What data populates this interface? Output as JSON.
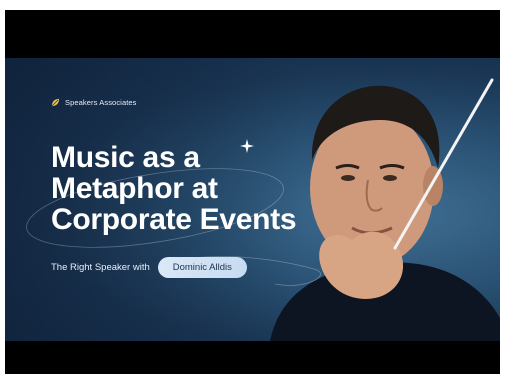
{
  "brand": {
    "name": "Speakers Associates",
    "logo_icon": "leaf-logo-icon"
  },
  "headline": {
    "line1": "Music as a",
    "line2": "Metaphor at",
    "line3": "Corporate Events"
  },
  "tagline": {
    "text": "The Right Speaker with",
    "speaker": "Dominic Alldis"
  },
  "colors": {
    "background": "#1a3654",
    "accent": "#dbe8f7",
    "letterbox": "#000000",
    "headline": "#ffffff"
  },
  "icons": {
    "sparkle": "sparkle-icon",
    "baton": "conductor-baton"
  }
}
